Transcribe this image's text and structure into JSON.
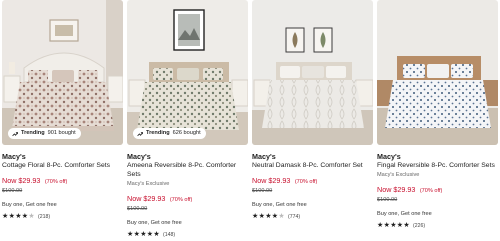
{
  "products": [
    {
      "brand": "Macy's",
      "title": "Cottage Floral 8-Pc. Comforter Sets",
      "exclusive": "",
      "sale_price": "Now $29.93",
      "discount": "(70% off)",
      "original_price": "$100.00",
      "promo": "Buy one, Get one free",
      "rating": 3.5,
      "review_count": "(218)",
      "trending": {
        "label": "Trending",
        "count": "901 bought"
      }
    },
    {
      "brand": "Macy's",
      "title": "Ameena Reversible 8-Pc. Comforter Sets",
      "exclusive": "Macy's Exclusive",
      "sale_price": "Now $29.93",
      "discount": "(70% off)",
      "original_price": "$100.00",
      "promo": "Buy one, Get one free",
      "rating": 4.5,
      "review_count": "(148)",
      "trending": {
        "label": "Trending",
        "count": "626 bought"
      }
    },
    {
      "brand": "Macy's",
      "title": "Neutral Damask 8-Pc. Comforter Set",
      "exclusive": "",
      "sale_price": "Now $29.93",
      "discount": "(70% off)",
      "original_price": "$100.00",
      "promo": "Buy one, Get one free",
      "rating": 3.5,
      "review_count": "(774)",
      "trending": null
    },
    {
      "brand": "Macy's",
      "title": "Fingal Reversible 8-Pc. Comforter Sets",
      "exclusive": "Macy's Exclusive",
      "sale_price": "Now $29.93",
      "discount": "(70% off)",
      "original_price": "$100.00",
      "promo": "Buy one, Get one free",
      "rating": 4.5,
      "review_count": "(226)",
      "trending": null
    }
  ],
  "icons": {
    "trending": "trending-up-icon",
    "star": "star-icon"
  },
  "colors": {
    "sale": "#c8102e",
    "text": "#222222"
  }
}
